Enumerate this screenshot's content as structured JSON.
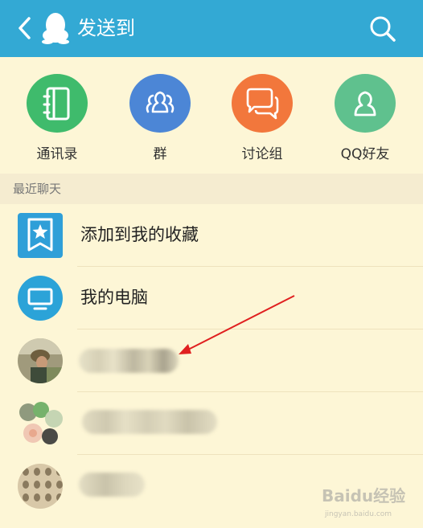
{
  "header": {
    "title": "发送到"
  },
  "quick_actions": [
    {
      "label": "通讯录",
      "icon": "contacts-book-icon",
      "color": "#3fbb6c"
    },
    {
      "label": "群",
      "icon": "group-icon",
      "color": "#4c86d6"
    },
    {
      "label": "讨论组",
      "icon": "discussion-icon",
      "color": "#f2773c"
    },
    {
      "label": "QQ好友",
      "icon": "friend-icon",
      "color": "#5fc18e"
    }
  ],
  "recent": {
    "header": "最近聊天",
    "items": [
      {
        "label": "添加到我的收藏",
        "icon": "favorites-star-icon"
      },
      {
        "label": "我的电脑",
        "icon": "computer-monitor-icon"
      }
    ]
  },
  "watermark": {
    "text": "Baidu经验",
    "subtext": "jingyan.baidu.com"
  },
  "colors": {
    "header_bg": "#33a9d4",
    "page_bg": "#fdf6d6",
    "annotation_arrow": "#e02020"
  }
}
